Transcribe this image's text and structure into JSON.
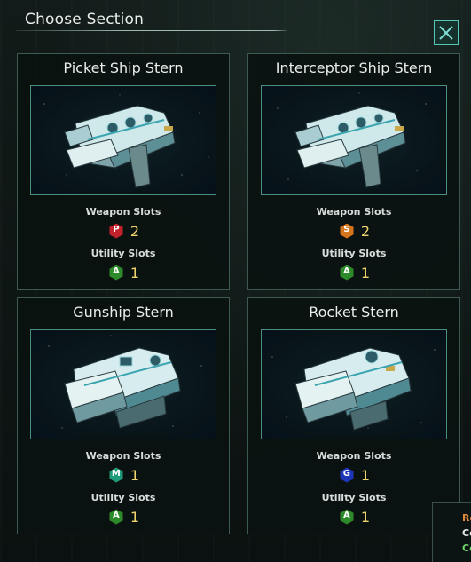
{
  "dialog": {
    "title": "Choose Section",
    "close_label": "close"
  },
  "sections": [
    {
      "name": "Picket Ship Stern",
      "weapon_label": "Weapon Slots",
      "weapon_type": "P",
      "weapon_color": "#c2222c",
      "weapon_count": "2",
      "utility_label": "Utility Slots",
      "utility_type": "A",
      "utility_color": "#2d8a2a",
      "utility_count": "1"
    },
    {
      "name": "Interceptor Ship Stern",
      "weapon_label": "Weapon Slots",
      "weapon_type": "S",
      "weapon_color": "#d4751d",
      "weapon_count": "2",
      "utility_label": "Utility Slots",
      "utility_type": "A",
      "utility_color": "#2d8a2a",
      "utility_count": "1"
    },
    {
      "name": "Gunship Stern",
      "weapon_label": "Weapon Slots",
      "weapon_type": "M",
      "weapon_color": "#1e9a7a",
      "weapon_count": "1",
      "utility_label": "Utility Slots",
      "utility_type": "A",
      "utility_color": "#2d8a2a",
      "utility_count": "1"
    },
    {
      "name": "Rocket Stern",
      "weapon_label": "Weapon Slots",
      "weapon_type": "G",
      "weapon_color": "#1c36b8",
      "weapon_count": "1",
      "utility_label": "Utility Slots",
      "utility_type": "A",
      "utility_color": "#2d8a2a",
      "utility_count": "1"
    }
  ],
  "corner_panel": {
    "line1": "Ro",
    "line2": "Co",
    "line3": "Co"
  },
  "colors": {
    "accent": "#55c7b8",
    "slot_count": "#f0d36a",
    "border": "#3c5a52"
  }
}
